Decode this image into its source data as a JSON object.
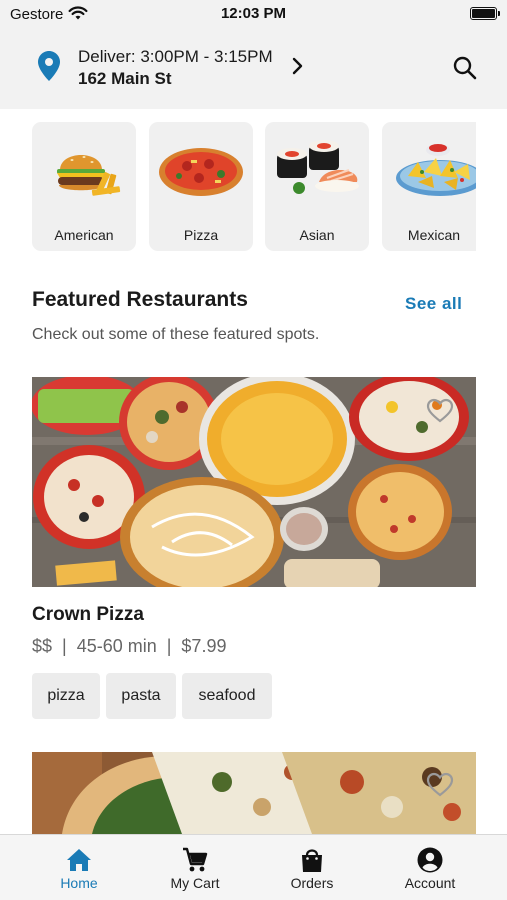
{
  "status_bar": {
    "carrier": "Gestore",
    "time": "12:03 PM"
  },
  "header": {
    "deliver_text": "Deliver: 3:00PM - 3:15PM",
    "address": "162 Main St",
    "icons": {
      "location": "location-pin-icon",
      "chevron": "chevron-right-icon",
      "search": "search-icon"
    }
  },
  "categories": [
    {
      "label": "American",
      "icon": "burger-icon"
    },
    {
      "label": "Pizza",
      "icon": "pizza-icon"
    },
    {
      "label": "Asian",
      "icon": "sushi-icon"
    },
    {
      "label": "Mexican",
      "icon": "nachos-icon"
    }
  ],
  "featured": {
    "title": "Featured Restaurants",
    "see_all": "See all",
    "subtitle": "Check out some of these featured spots."
  },
  "restaurants": [
    {
      "name": "Crown Pizza",
      "meta": "$$  |  45-60 min  |  $7.99",
      "tags": [
        "pizza",
        "pasta",
        "seafood"
      ]
    }
  ],
  "tabs": [
    {
      "label": "Home",
      "icon": "home-icon",
      "active": true
    },
    {
      "label": "My Cart",
      "icon": "cart-icon",
      "active": false
    },
    {
      "label": "Orders",
      "icon": "shopping-bag-icon",
      "active": false
    },
    {
      "label": "Account",
      "icon": "account-icon",
      "active": false
    }
  ],
  "colors": {
    "accent": "#1a7bb6",
    "header_bg": "#f2f2f2",
    "card_bg": "#f0f0f0"
  }
}
